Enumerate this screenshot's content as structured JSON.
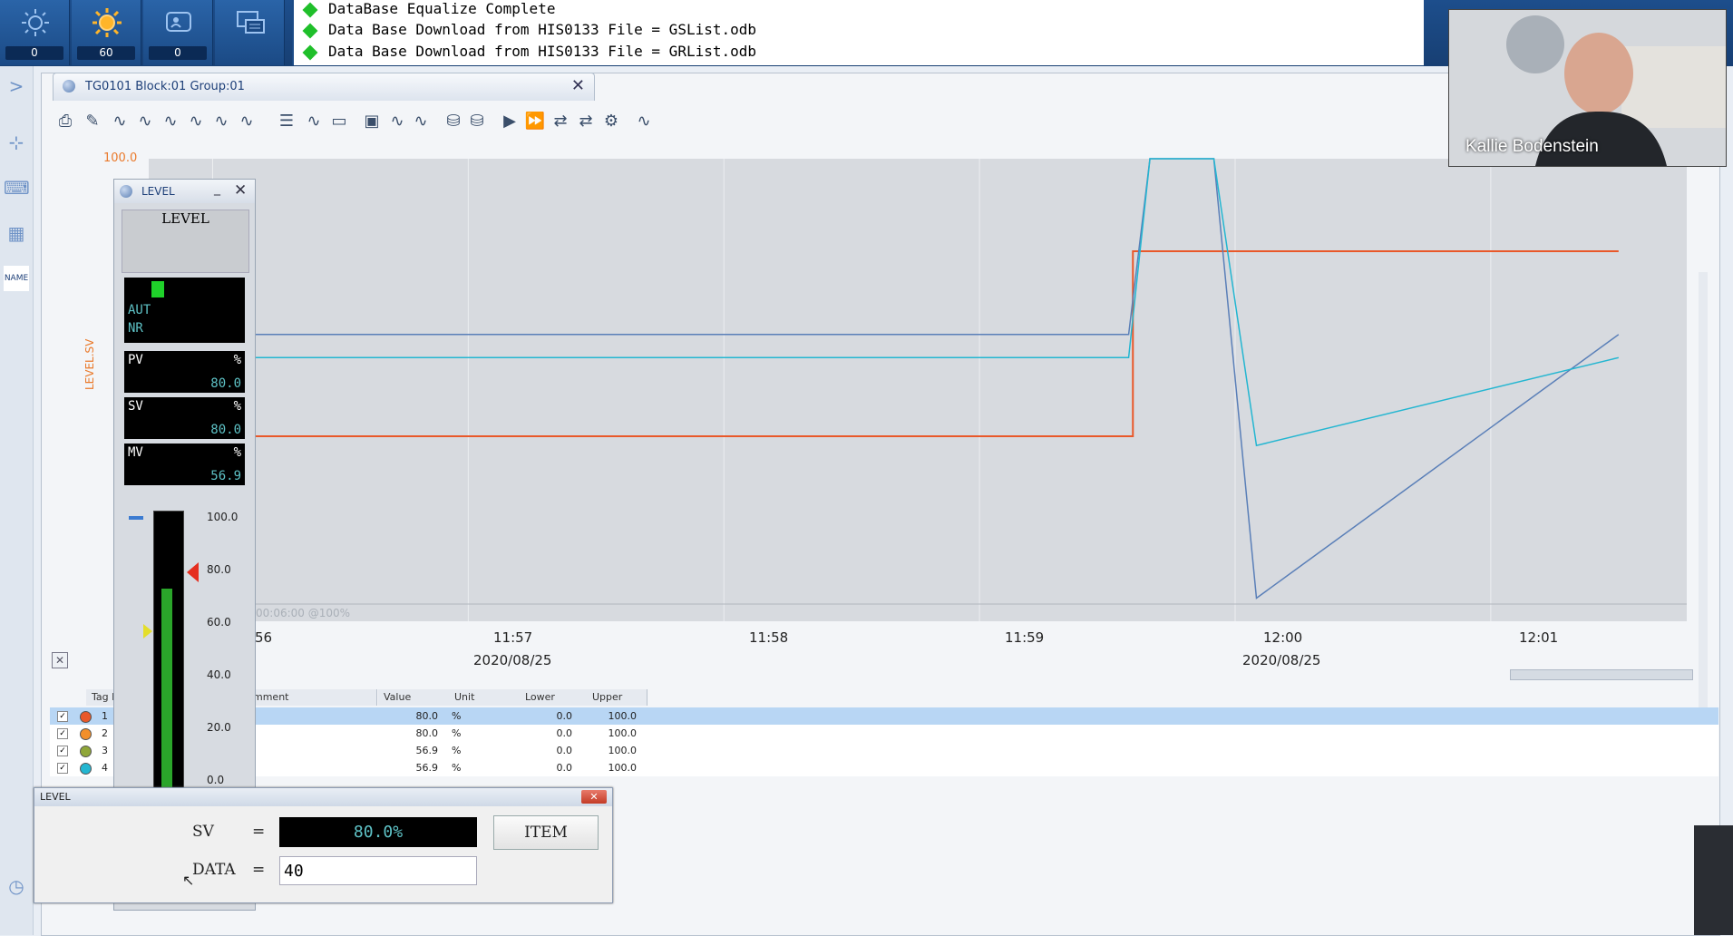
{
  "topbar": {
    "buttons": [
      {
        "icon": "process-alarm-icon",
        "count": "0"
      },
      {
        "icon": "system-alarm-icon",
        "count": "60"
      },
      {
        "icon": "operator-guide-icon",
        "count": "0"
      },
      {
        "icon": "message-monitor-icon",
        "count": ""
      }
    ],
    "messages": [
      "DataBase Equalize Complete",
      "Data Base Download from HIS0133 File = GSList.odb",
      "Data Base Download from HIS0133 File = GRList.odb"
    ]
  },
  "trend": {
    "tab_title": "TG0101 Block:01 Group:01",
    "y_max_label": "100.0",
    "y_axis_label": "LEVEL.SV",
    "overlay_label": "00:06:00  @100%",
    "time_ticks": [
      "56",
      "11:57",
      "11:58",
      "11:59",
      "12:00",
      "12:01"
    ],
    "date_ticks": [
      "2020/08/25",
      "2020/08/25"
    ]
  },
  "table": {
    "headers": [
      "Tag N",
      "mment",
      "Value",
      "Unit",
      "Lower",
      "Upper"
    ],
    "rows": [
      {
        "no": "1",
        "color": "#e9582a",
        "value": "80.0",
        "unit": "%",
        "lower": "0.0",
        "upper": "100.0"
      },
      {
        "no": "2",
        "color": "#f28f2a",
        "value": "80.0",
        "unit": "%",
        "lower": "0.0",
        "upper": "100.0"
      },
      {
        "no": "3",
        "color": "#8fa638",
        "value": "56.9",
        "unit": "%",
        "lower": "0.0",
        "upper": "100.0"
      },
      {
        "no": "4",
        "color": "#23b6d1",
        "value": "56.9",
        "unit": "%",
        "lower": "0.0",
        "upper": "100.0"
      }
    ]
  },
  "faceplate": {
    "title": "LEVEL",
    "tag": "LEVEL",
    "mode": "AUT",
    "alarm": "NR",
    "pv_label": "PV",
    "pv_unit": "%",
    "pv_value": "80.0",
    "sv_label": "SV",
    "sv_unit": "%",
    "sv_value": "80.0",
    "mv_label": "MV",
    "mv_unit": "%",
    "mv_value": "56.9",
    "scale": [
      "100.0",
      "80.0",
      "60.0",
      "40.0",
      "20.0",
      "0.0"
    ],
    "bar_level": 0.8
  },
  "dialog": {
    "title": "LEVEL",
    "sv_label": "SV",
    "eq": "=",
    "sv_value": "80.0%",
    "item_label": "ITEM",
    "data_label": "DATA",
    "data_value": "40"
  },
  "webcam": {
    "name": "Kallie Bodenstein"
  },
  "chart_data": {
    "type": "line",
    "x_ticks": [
      "11:56",
      "11:57",
      "11:58",
      "11:59",
      "12:00",
      "12:01"
    ],
    "ylim": [
      0,
      100
    ],
    "series": [
      {
        "name": "LEVEL.SV",
        "color": "#e9582a",
        "x": [
          "11:56",
          "11:59:35",
          "11:59:36",
          "12:01:30"
        ],
        "values": [
          40,
          40,
          80,
          80
        ]
      },
      {
        "name": "",
        "color": "#5a7fb8",
        "x": [
          "11:56",
          "11:59:35",
          "11:59:40",
          "11:59:55",
          "12:00:05",
          "12:01:30"
        ],
        "values": [
          62,
          62,
          100,
          100,
          5,
          62
        ]
      },
      {
        "name": "",
        "color": "#23b6d1",
        "x": [
          "11:56",
          "11:59:35",
          "11:59:40",
          "11:59:55",
          "12:00:05",
          "12:01:30"
        ],
        "values": [
          57,
          57,
          100,
          100,
          38,
          57
        ]
      }
    ]
  }
}
